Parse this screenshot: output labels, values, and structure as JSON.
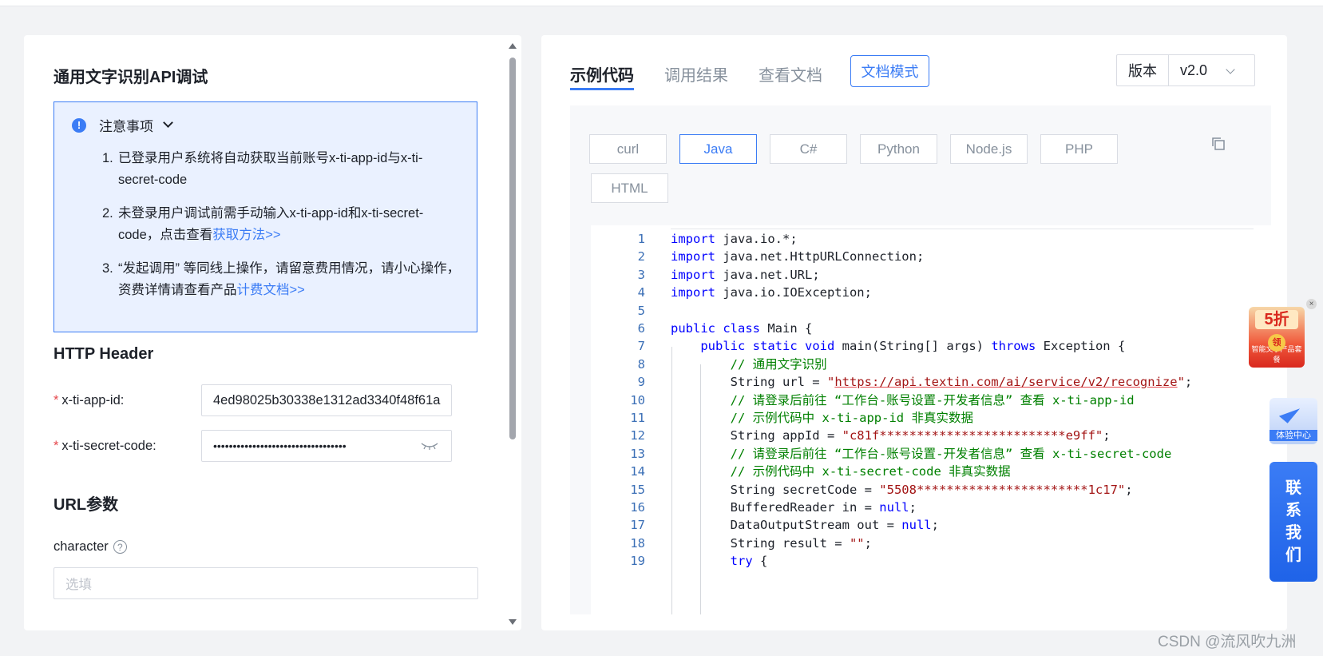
{
  "left": {
    "title": "通用文字识别API调试",
    "notice": {
      "header": "注意事项",
      "items": [
        {
          "num": "1.",
          "text": "已登录用户系统将自动获取当前账号x-ti-app-id与x-ti-secret-code",
          "link": ""
        },
        {
          "num": "2.",
          "text": "未登录用户调试前需手动输入x-ti-app-id和x-ti-secret-code，点击查看",
          "link": "获取方法>>"
        },
        {
          "num": "3.",
          "text": "“发起调用” 等同线上操作，请留意费用情况，请小心操作，资费详情请查看产品",
          "link": "计费文档>>"
        }
      ]
    },
    "http_header_title": "HTTP Header",
    "app_id_label": "x-ti-app-id:",
    "app_id_value": "4ed98025b30338e1312ad3340f48f61a",
    "secret_label": "x-ti-secret-code:",
    "secret_value": "••••••••••••••••••••••••••••••••••",
    "url_params_title": "URL参数",
    "character_label": "character",
    "help_glyph": "?",
    "character_placeholder": "选填",
    "required_mark": "*"
  },
  "right": {
    "tabs": [
      "示例代码",
      "调用结果",
      "查看文档"
    ],
    "active_tab": 0,
    "doc_mode_button": "文档模式",
    "version_label": "版本",
    "version_value": "v2.0",
    "languages": [
      "curl",
      "Java",
      "C#",
      "Python",
      "Node.js",
      "PHP",
      "HTML"
    ],
    "active_language": "Java",
    "code_lines": [
      {
        "n": "1",
        "t": "import java.io.*;"
      },
      {
        "n": "2",
        "t": "import java.net.HttpURLConnection;"
      },
      {
        "n": "3",
        "t": "import java.net.URL;"
      },
      {
        "n": "4",
        "t": "import java.io.IOException;"
      },
      {
        "n": "5",
        "t": ""
      },
      {
        "n": "6",
        "t": "public class Main {"
      },
      {
        "n": "7",
        "t": "    public static void main(String[] args) throws Exception {"
      },
      {
        "n": "8",
        "t": "        // 通用文字识别"
      },
      {
        "n": "9",
        "t": "        String url = \"https://api.textin.com/ai/service/v2/recognize\";"
      },
      {
        "n": "10",
        "t": "        // 请登录后前往 “工作台-账号设置-开发者信息” 查看 x-ti-app-id"
      },
      {
        "n": "11",
        "t": "        // 示例代码中 x-ti-app-id 非真实数据"
      },
      {
        "n": "12",
        "t": "        String appId = \"c81f*************************e9ff\";"
      },
      {
        "n": "13",
        "t": "        // 请登录后前往 “工作台-账号设置-开发者信息” 查看 x-ti-secret-code"
      },
      {
        "n": "14",
        "t": "        // 示例代码中 x-ti-secret-code 非真实数据"
      },
      {
        "n": "15",
        "t": "        String secretCode = \"5508***********************1c17\";"
      },
      {
        "n": "16",
        "t": "        BufferedReader in = null;"
      },
      {
        "n": "17",
        "t": "        DataOutputStream out = null;"
      },
      {
        "n": "18",
        "t": "        String result = \"\";"
      },
      {
        "n": "19",
        "t": "        try {"
      }
    ]
  },
  "widgets": {
    "promo_text": "5折",
    "promo_coin": "领",
    "promo_sub": "智能文字产品套餐",
    "close_glyph": "×",
    "experience_center": "体验中心",
    "contact": [
      "联",
      "系",
      "我",
      "们"
    ]
  },
  "watermark": "CSDN @流风吹九洲",
  "colors": {
    "accent": "#3b7cf5",
    "keyword": "#0000ff",
    "string": "#a31515",
    "comment": "#008000"
  }
}
